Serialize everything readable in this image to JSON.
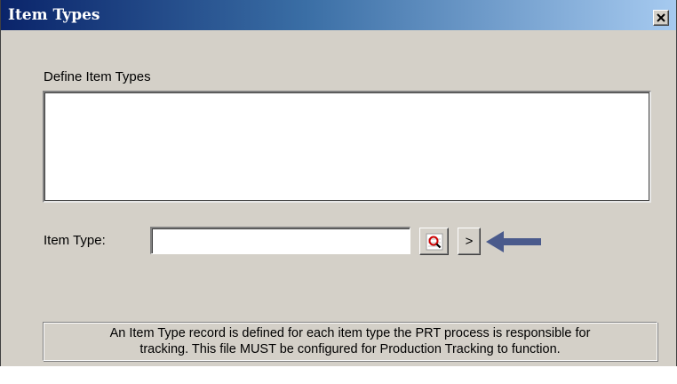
{
  "window": {
    "title": "Item Types",
    "close_symbol": "✕"
  },
  "section": {
    "label": "Define Item Types"
  },
  "item_type": {
    "label": "Item Type:",
    "value": "",
    "next_label": ">"
  },
  "info": {
    "line1": "An Item Type record is defined for each item type the PRT process is responsible for",
    "line2": "tracking.  This file MUST be configured for Production Tracking to function."
  },
  "icons": {
    "lookup": "magnifier-lookup-icon",
    "pointer": "left-arrow-callout-icon",
    "close": "close-icon"
  },
  "colors": {
    "titlebar_start": "#0a246a",
    "titlebar_end": "#a6caf0",
    "window_bg": "#d4d0c8",
    "arrow": "#4a5a8c"
  }
}
